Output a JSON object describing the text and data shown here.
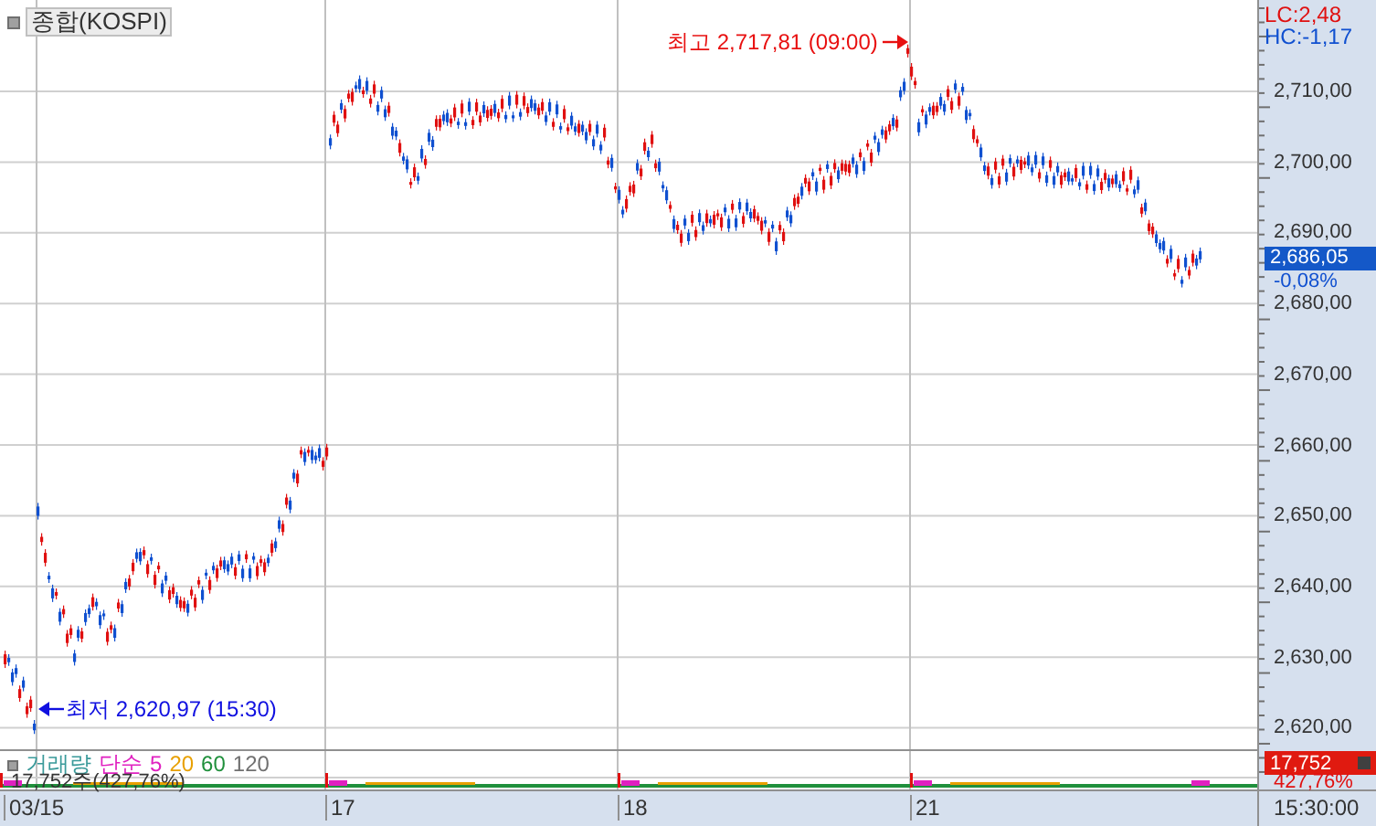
{
  "chart": {
    "title": "종합(KOSPI)",
    "lc": "LC:2,48",
    "hc": "HC:-1,17",
    "high_label": "최고 2,717,81 (09:00)",
    "low_label": "최저 2,620,97 (15:30)",
    "y_ticks": [
      "2,710,00",
      "2,700,00",
      "2,690,00",
      "2,680,00",
      "2,670,00",
      "2,660,00",
      "2,650,00",
      "2,640,00",
      "2,630,00",
      "2,620,00"
    ],
    "current": {
      "price": "2,686,05",
      "change": "-0,08%"
    }
  },
  "volume": {
    "title": "거래량",
    "ma_type": "단순",
    "ma": [
      {
        "label": "5",
        "color": "#e020c0"
      },
      {
        "label": "20",
        "color": "#e8a000"
      },
      {
        "label": "60",
        "color": "#20903c"
      },
      {
        "label": "120",
        "color": "#707070"
      }
    ],
    "value": "17,752주(427,76%)",
    "badge": "17,752",
    "ratio": "427,76%"
  },
  "x_axis": {
    "dates": [
      "03/15",
      "17",
      "18",
      "21"
    ],
    "time": "15:30:00"
  }
}
